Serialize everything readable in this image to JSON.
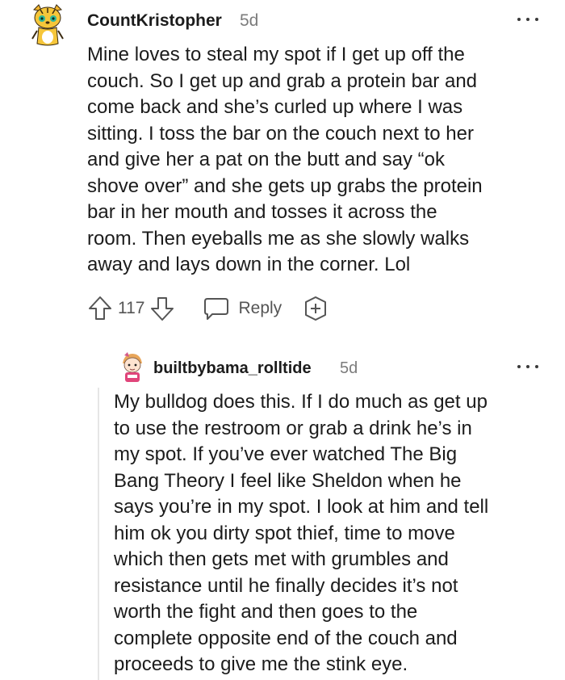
{
  "comments": [
    {
      "username": "CountKristopher",
      "time": "5d",
      "avatar": "tiger-avatar-icon",
      "body": "Mine loves to steal my spot if I get up off the\ncouch. So I get up and grab a protein bar and\ncome back and she’s curled up where I was\nsitting. I toss the bar on the couch next to her\nand give her a pat on the butt and say “ok\nshove over” and she gets up grabs the protein\nbar in her mouth and tosses it across the\nroom. Then eyeballs me as she slowly walks\naway and lays down in the corner. Lol",
      "votes": "117",
      "reply_label": "Reply"
    },
    {
      "username": "builtbybama_rolltide",
      "time": "5d",
      "avatar": "pink-character-avatar-icon",
      "body": "My bulldog does this. If I do much as get up\nto use the restroom or grab a drink he’s in\nmy spot. If you’ve ever watched The Big\nBang Theory I feel like Sheldon when he\nsays you’re in my spot. I look at him and tell\nhim ok you dirty spot thief, time to move\nwhich then gets met with grumbles and\nresistance until he finally decides it’s not\nworth the fight and then goes to the\ncomplete opposite end of the couch and\nproceeds to give me the stink eye."
    }
  ],
  "icons": {
    "upvote": "upvote-arrow-icon",
    "downvote": "downvote-arrow-icon",
    "reply": "speech-bubble-icon",
    "award": "plus-award-icon",
    "more": "more-options-icon"
  },
  "colors": {
    "text": "#1c1c1c",
    "meta": "#7c7c7c",
    "icon": "#555555",
    "thread_line": "#e6e6e6"
  }
}
